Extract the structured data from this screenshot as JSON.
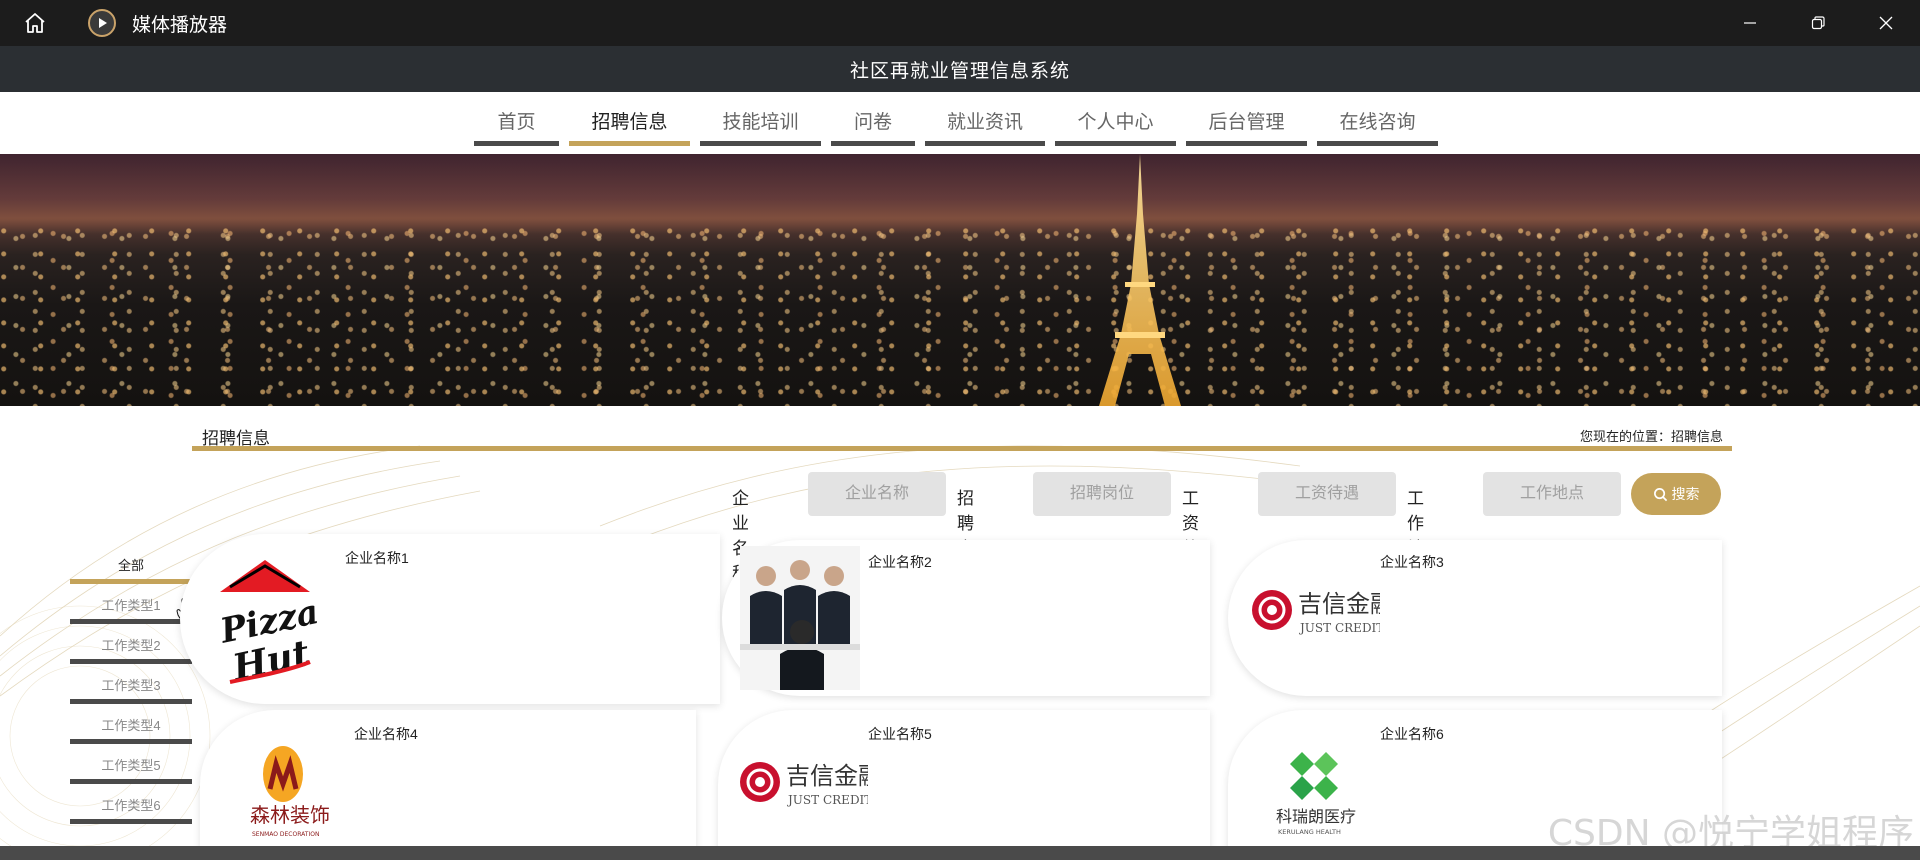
{
  "player": {
    "app_title": "媒体播放器",
    "icons": [
      "home-icon",
      "play-icon",
      "minimize-icon",
      "restore-icon",
      "close-icon"
    ]
  },
  "site": {
    "title": "社区再就业管理信息系统"
  },
  "nav": {
    "items": [
      {
        "label": "首页",
        "active": false
      },
      {
        "label": "招聘信息",
        "active": true
      },
      {
        "label": "技能培训",
        "active": false
      },
      {
        "label": "问卷",
        "active": false
      },
      {
        "label": "就业资讯",
        "active": false
      },
      {
        "label": "个人中心",
        "active": false
      },
      {
        "label": "后台管理",
        "active": false
      },
      {
        "label": "在线咨询",
        "active": false
      }
    ]
  },
  "section": {
    "title": "招聘信息",
    "breadcrumb": "您现在的位置：招聘信息"
  },
  "search": {
    "company_label": "企业名称",
    "company_placeholder": "企业名称",
    "position_label": "招聘岗位",
    "position_placeholder": "招聘岗位",
    "salary_label": "工资待遇",
    "salary_placeholder": "工资待遇",
    "location_label": "工作地点",
    "location_placeholder": "工作地点",
    "button_label": "搜索"
  },
  "sidebar": {
    "items": [
      {
        "label": "全部",
        "active": true
      },
      {
        "label": "工作类型1",
        "active": false
      },
      {
        "label": "工作类型2",
        "active": false
      },
      {
        "label": "工作类型3",
        "active": false
      },
      {
        "label": "工作类型4",
        "active": false
      },
      {
        "label": "工作类型5",
        "active": false
      },
      {
        "label": "工作类型6",
        "active": false
      }
    ]
  },
  "cards": [
    {
      "name": "企业名称1"
    },
    {
      "name": "企业名称2"
    },
    {
      "name": "企业名称3"
    },
    {
      "name": "企业名称4"
    },
    {
      "name": "企业名称5"
    },
    {
      "name": "企业名称6"
    }
  ],
  "logos": {
    "pizza_hut_line1": "Pizza",
    "pizza_hut_line2": "Hut",
    "jixin_cn": "吉信金融",
    "jixin_en": "JUST CREDIT",
    "senmao_cn": "森林装饰",
    "senmao_en": "SENMAO DECORATION",
    "kerui_cn": "科瑞朗医疗",
    "kerui_en": "KERULANG HEALTH"
  },
  "watermark": "CSDN @悦宁学姐程序",
  "colors": {
    "accent": "#c4a35a",
    "nav_underline": "#4a4a4a",
    "header_bg": "#2b2f33",
    "player_bg": "#1c1c1c"
  }
}
